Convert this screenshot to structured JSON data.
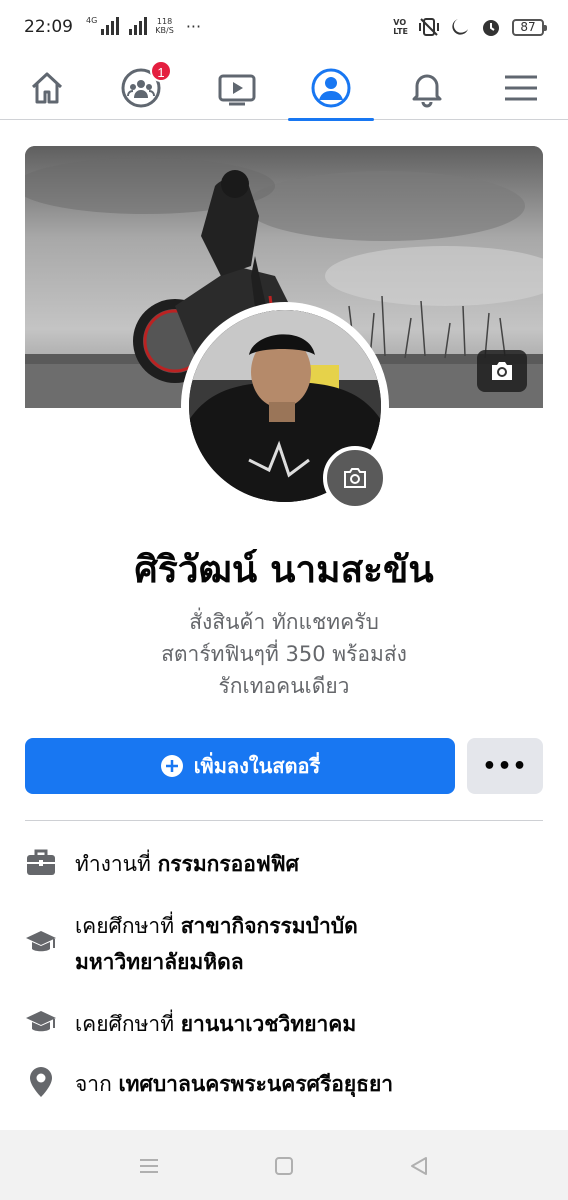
{
  "status_bar": {
    "time": "22:09",
    "network_tag": "4G",
    "speed_value": "118",
    "speed_unit": "KB/S",
    "more": "···",
    "volte_top": "VO",
    "volte_bottom": "LTE",
    "battery": "87"
  },
  "nav": {
    "items": [
      {
        "icon": "home-icon"
      },
      {
        "icon": "friends-icon",
        "badge": "1"
      },
      {
        "icon": "watch-video-icon"
      },
      {
        "icon": "profile-icon",
        "active": true
      },
      {
        "icon": "bell-icon"
      },
      {
        "icon": "menu-icon"
      }
    ],
    "active_color": "#1877f2",
    "badge_color": "#e41e3f"
  },
  "profile": {
    "name": "ศิริวัฒน์ นามสะขัน",
    "bio_lines": [
      "สั่งสินค้า ทักแชทครับ",
      "สตาร์ทฟินๆที่ 350 พร้อมส่ง",
      "รักเทอคนเดียว"
    ]
  },
  "actions": {
    "add_story_label": "เพิ่มลงในสตอรี่",
    "more_label": "•••"
  },
  "details": [
    {
      "icon": "briefcase-icon",
      "prefix": "ทำงานที่ ",
      "value": "กรรมกรออฟฟิศ"
    },
    {
      "icon": "graduation-cap-icon",
      "prefix": "เคยศึกษาที่ ",
      "value": "สาขากิจกรรมบำบัด",
      "value_line2": "มหาวิทยาลัยมหิดล"
    },
    {
      "icon": "graduation-cap-icon",
      "prefix": "เคยศึกษาที่ ",
      "value": "ยานนาเวชวิทยาคม"
    },
    {
      "icon": "location-pin-icon",
      "prefix": "จาก ",
      "value": "เทศบาลนครพระนครศรีอยุธยา"
    }
  ]
}
